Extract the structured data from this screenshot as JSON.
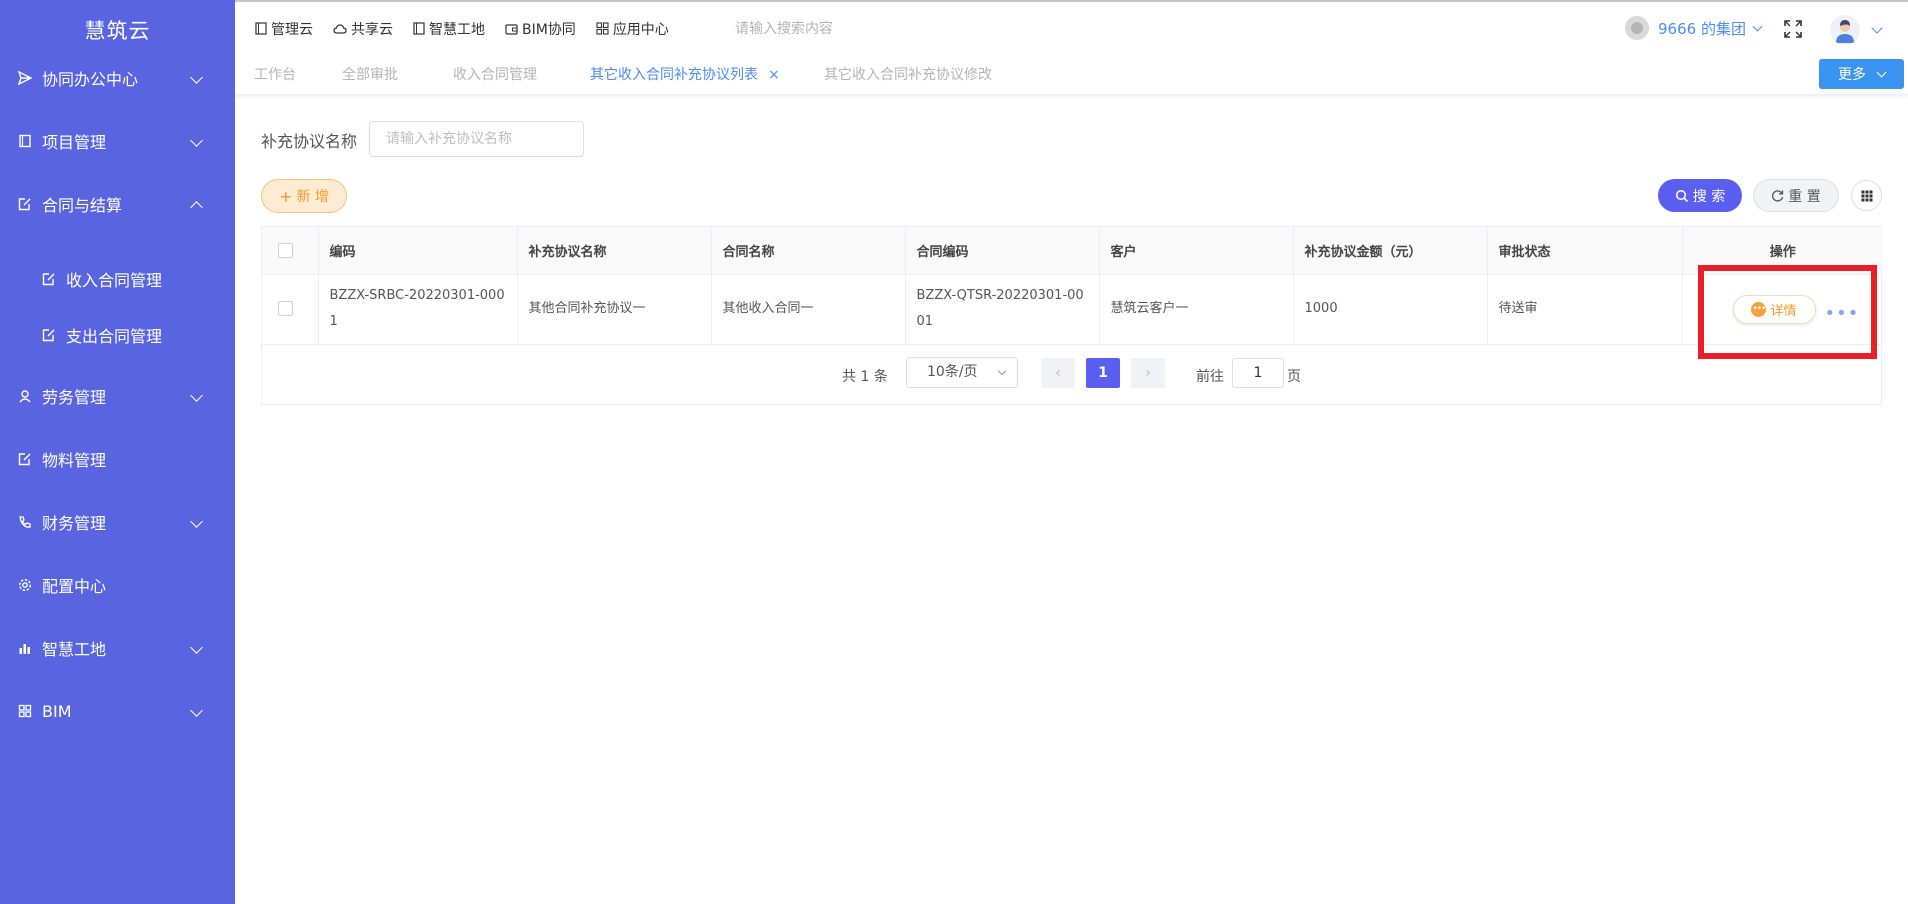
{
  "app": {
    "logo": "慧筑云"
  },
  "sidebar": {
    "items": [
      {
        "label": "协同办公中心"
      },
      {
        "label": "项目管理"
      },
      {
        "label": "合同与结算"
      },
      {
        "label": "收入合同管理"
      },
      {
        "label": "支出合同管理"
      },
      {
        "label": "劳务管理"
      },
      {
        "label": "物料管理"
      },
      {
        "label": "财务管理"
      },
      {
        "label": "配置中心"
      },
      {
        "label": "智慧工地"
      },
      {
        "label": "BIM"
      }
    ]
  },
  "topnav": {
    "items": [
      {
        "label": "管理云"
      },
      {
        "label": "共享云"
      },
      {
        "label": "智慧工地"
      },
      {
        "label": "BIM协同"
      },
      {
        "label": "应用中心"
      }
    ],
    "search_placeholder": "请输入搜索内容",
    "group_name": "9666 的集团"
  },
  "tabs": {
    "items": [
      {
        "label": "工作台"
      },
      {
        "label": "全部审批"
      },
      {
        "label": "收入合同管理"
      },
      {
        "label": "其它收入合同补充协议列表",
        "close": "×"
      },
      {
        "label": "其它收入合同补充协议修改"
      }
    ],
    "more_label": "更多"
  },
  "filter": {
    "label": "补充协议名称",
    "placeholder": "请输入补充协议名称"
  },
  "toolbar": {
    "add_plus": "+",
    "add_label": "新 增",
    "search_label": "搜 索",
    "reset_label": "重 置"
  },
  "table": {
    "headers": [
      "编码",
      "补充协议名称",
      "合同名称",
      "合同编码",
      "客户",
      "补充协议金额（元）",
      "审批状态",
      "操作"
    ],
    "rows": [
      {
        "code": "BZZX-SRBC-20220301-0001",
        "agreement_name": "其他合同补充协议一",
        "contract_name": "其他收入合同一",
        "contract_code": "BZZX-QTSR-20220301-0001",
        "customer": "慧筑云客户一",
        "amount": "1000",
        "status": "待送审",
        "detail_label": "详情",
        "more": "•••"
      }
    ]
  },
  "pagination": {
    "total": "共 1 条",
    "page_size": "10条/页",
    "prev": "‹",
    "current": "1",
    "next": "›",
    "goto_label": "前往",
    "goto_value": "1",
    "page_suffix": "页"
  },
  "colors": {
    "sidebar_bg": "#5864e0",
    "primary": "#5b5fef",
    "accent_blue": "#4e8cf0",
    "orange": "#f29a2e",
    "highlight_red": "#ea1f27"
  }
}
